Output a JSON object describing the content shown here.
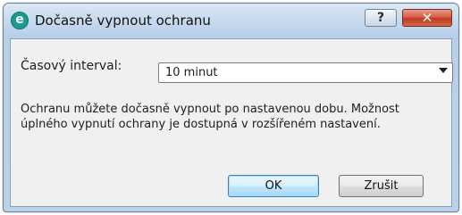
{
  "window": {
    "title": "Dočasně vypnout ochranu",
    "app_icon_letter": "e",
    "help_label": "?",
    "close_label": "✕"
  },
  "form": {
    "interval_label": "Časový interval:",
    "interval_selected": "10 minut",
    "info_text": "Ochranu můžete dočasně vypnout po nastavenou dobu. Možnost úplného vypnutí ochrany je dostupná v rozšířeném nastavení."
  },
  "buttons": {
    "ok": "OK",
    "cancel": "Zrušit"
  },
  "colors": {
    "accent": "#1c9a8f",
    "close": "#c0391f",
    "ok_border": "#3c7fb1"
  }
}
